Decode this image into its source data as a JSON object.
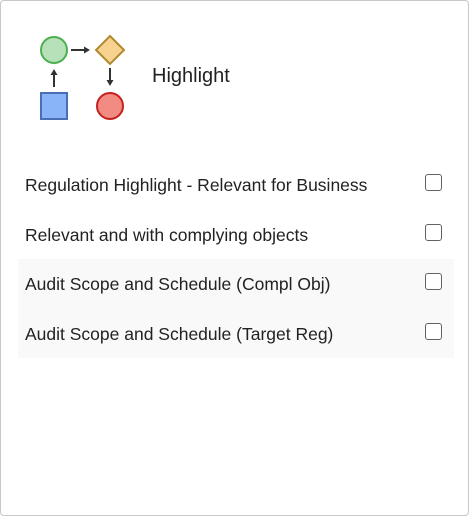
{
  "header": {
    "title": "Highlight",
    "logo_icon": "process-flow-icon",
    "logo_colors": {
      "circle_green": "#b7e1b9",
      "diamond_yellow": "#f8d38f",
      "square_blue": "#8ab4f8",
      "circle_red": "#f28b82"
    }
  },
  "options": [
    {
      "label": "Regulation Highlight - Relevant for Business",
      "checked": false
    },
    {
      "label": "Relevant and with complying objects",
      "checked": false
    },
    {
      "label": "Audit Scope and Schedule (Compl Obj)",
      "checked": false
    },
    {
      "label": "Audit Scope and Schedule (Target Reg)",
      "checked": false
    }
  ]
}
